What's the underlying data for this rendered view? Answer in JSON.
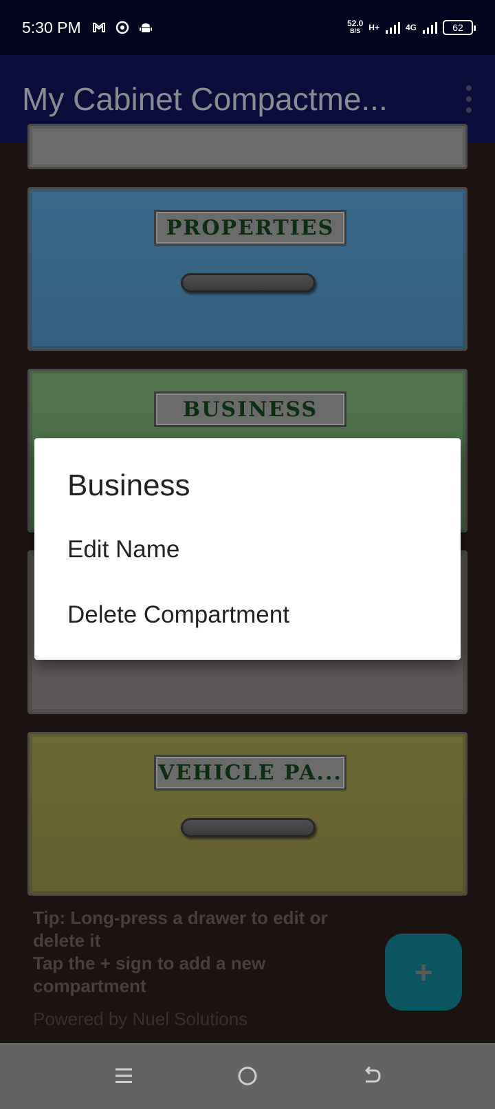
{
  "status_bar": {
    "time": "5:30 PM",
    "net_speed": "52.0",
    "net_speed_unit": "B/S",
    "signal1_label": "H+",
    "signal2_label": "4G",
    "battery": "62",
    "icons": [
      "gmail-icon",
      "chrome-icon",
      "android-icon",
      "signal-icon",
      "battery-icon"
    ]
  },
  "app_bar": {
    "title": "My Cabinet Compactme..."
  },
  "drawers": [
    {
      "label": "",
      "color": "#6b6b6b"
    },
    {
      "label": "PROPERTIES",
      "color": "#3f6f8f"
    },
    {
      "label": "BUSINESS",
      "color": "#4e7048"
    },
    {
      "label": "",
      "color": "#5d5757"
    },
    {
      "label": "VEHICLE PA...",
      "color": "#6a6634"
    }
  ],
  "dialog": {
    "title": "Business",
    "items": [
      "Edit Name",
      "Delete Compartment"
    ]
  },
  "tip": {
    "line1": "Tip: Long-press a drawer to edit or delete it",
    "line2": "Tap the + sign to add a new compartment"
  },
  "footer": {
    "powered_by": "Powered by Nuel Solutions"
  },
  "fab": {
    "label": "+",
    "color": "#0a5560"
  },
  "nav_bar": {
    "buttons": [
      "menu-icon",
      "home-icon",
      "back-icon"
    ]
  }
}
